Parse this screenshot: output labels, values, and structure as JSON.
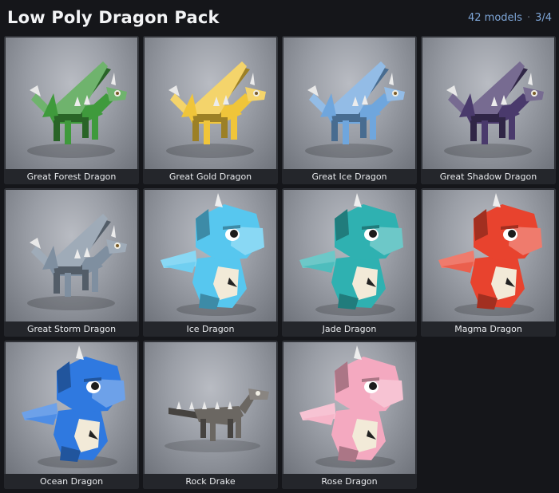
{
  "header": {
    "title": "Low Poly Dragon Pack",
    "count": "42 models",
    "separator": "·",
    "page": "3/4"
  },
  "models": [
    {
      "name": "Great Forest Dragon",
      "kind": "winged",
      "color": "#3f9a3c"
    },
    {
      "name": "Great Gold Dragon",
      "kind": "winged",
      "color": "#f0c53a"
    },
    {
      "name": "Great Ice Dragon",
      "kind": "winged",
      "color": "#6fa6dd"
    },
    {
      "name": "Great Shadow Dragon",
      "kind": "winged",
      "color": "#4a3a6c"
    },
    {
      "name": "Great Storm Dragon",
      "kind": "winged",
      "color": "#7f8fa0"
    },
    {
      "name": "Ice Dragon",
      "kind": "chibi",
      "color": "#57c7ef"
    },
    {
      "name": "Jade Dragon",
      "kind": "chibi",
      "color": "#2fb1b1"
    },
    {
      "name": "Magma Dragon",
      "kind": "chibi",
      "color": "#e8432e"
    },
    {
      "name": "Ocean Dragon",
      "kind": "chibi",
      "color": "#2f79e0"
    },
    {
      "name": "Rock Drake",
      "kind": "drake",
      "color": "#6b6762"
    },
    {
      "name": "Rose Dragon",
      "kind": "chibi",
      "color": "#f4a9c0"
    }
  ]
}
